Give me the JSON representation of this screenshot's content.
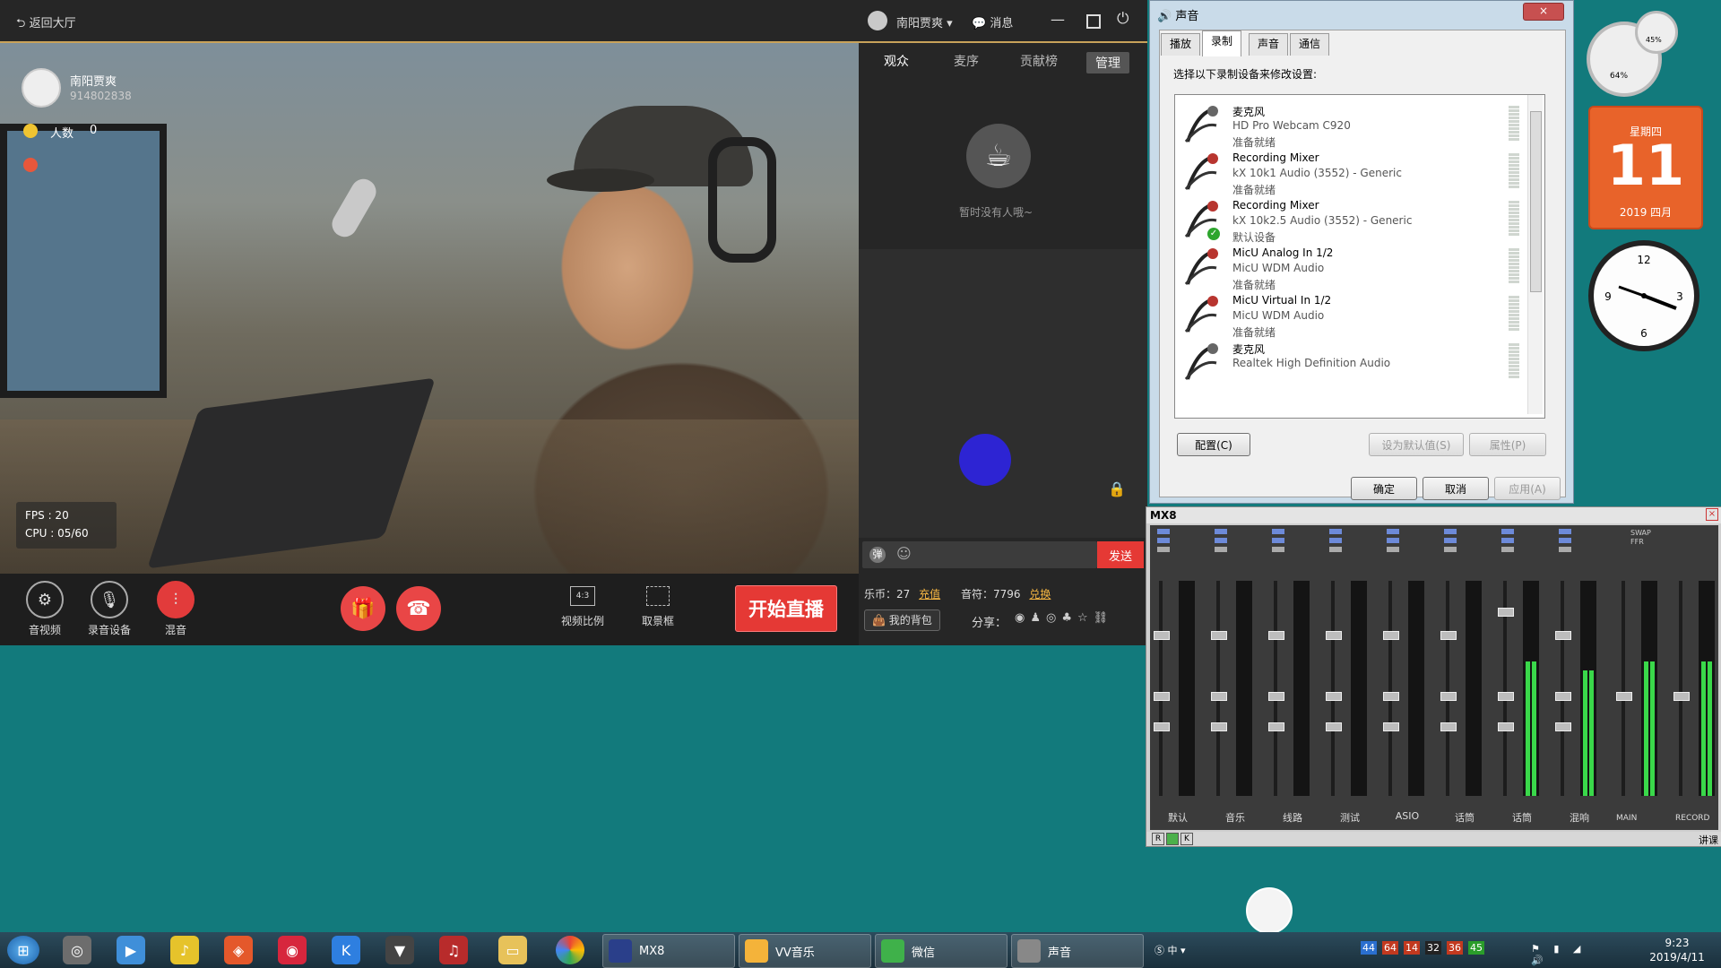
{
  "app": {
    "back_label": "返回大厅",
    "user_name": "南阳贾爽",
    "message_label": "消息",
    "anchor_name": "南阳贾爽",
    "anchor_id": "914802838",
    "viewers_label": "人数",
    "viewers_count": "0",
    "fps": "FPS : 20",
    "cpu": "CPU : 05/60",
    "controls": {
      "audio_video": "音视频",
      "record_device": "录音设备",
      "mix": "混音"
    },
    "ratio_icon": "4:3",
    "ratio_label": "视频比例",
    "frame_label": "取景框",
    "start_label": "开始直播",
    "coins": "乐币：27",
    "recharge": "充值",
    "notes": "音符：7796",
    "exchange": "兑换",
    "backpack": "我的背包",
    "share": "分享：",
    "tabs": [
      "观众",
      "麦序",
      "贡献榜",
      "管理"
    ],
    "empty_text": "暂时没有人哦~",
    "danmu": "弹",
    "send": "发送"
  },
  "dialog": {
    "title": "声音",
    "close": "×",
    "tabs": [
      "播放",
      "录制",
      "声音",
      "通信"
    ],
    "instruction": "选择以下录制设备来修改设置:",
    "devices": [
      {
        "name": "麦克风",
        "desc": "HD Pro Webcam C920",
        "status": "准备就绪",
        "default": false
      },
      {
        "name": "Recording Mixer",
        "desc": "kX 10k1 Audio (3552) - Generic",
        "status": "准备就绪",
        "default": false
      },
      {
        "name": "Recording Mixer",
        "desc": "kX 10k2.5 Audio (3552) - Generic",
        "status": "默认设备",
        "default": true
      },
      {
        "name": "MicU Analog In 1/2",
        "desc": "MicU WDM Audio",
        "status": "准备就绪",
        "default": false
      },
      {
        "name": "MicU Virtual In 1/2",
        "desc": "MicU WDM Audio",
        "status": "准备就绪",
        "default": false
      },
      {
        "name": "麦克风",
        "desc": "Realtek High Definition Audio",
        "status": "",
        "default": false
      }
    ],
    "configure": "配置(C)",
    "set_default": "设为默认值(S)",
    "properties": "属性(P)",
    "ok": "确定",
    "cancel": "取消",
    "apply": "应用(A)"
  },
  "mixer": {
    "title": "MX8",
    "channels": [
      "默认",
      "音乐",
      "线路",
      "测试",
      "ASIO",
      "话筒",
      "话筒",
      "混响"
    ],
    "master": [
      "MAIN",
      "RECORD"
    ],
    "swap": "SWAP",
    "ffr": "FFR",
    "footer_right": "讲课",
    "footer_btns": [
      "R",
      "K"
    ]
  },
  "gadgets": {
    "cal_weekday": "星期四",
    "cal_day": "11",
    "cal_month": "2019 四月",
    "cpu_pct": "64%",
    "mem_pct": "45%"
  },
  "taskbar": {
    "tasks": [
      "MX8",
      "VV音乐",
      "微信",
      "声音"
    ],
    "time": "9:23",
    "date": "2019/4/11",
    "tray_nums": [
      "44",
      "64",
      "14",
      "32",
      "36",
      "45"
    ]
  }
}
